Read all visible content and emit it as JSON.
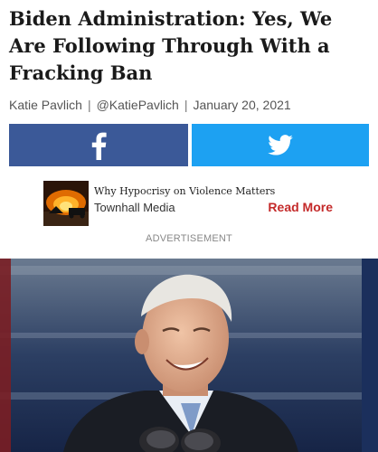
{
  "article": {
    "headline": "Biden Administration: Yes, We Are Following Through With a Fracking Ban",
    "author": "Katie Pavlich",
    "handle": "@KatiePavlich",
    "date": "January 20, 2021",
    "separator": "|"
  },
  "share": {
    "facebook_icon": "facebook-icon",
    "twitter_icon": "twitter-bird-icon",
    "colors": {
      "facebook": "#3b5998",
      "twitter": "#1da1f2"
    }
  },
  "promo": {
    "title": "Why Hypocrisy on Violence Matters",
    "source": "Townhall Media",
    "read_more": "Read More",
    "accent": "#c42a2a"
  },
  "ad": {
    "label": "ADVERTISEMENT"
  }
}
